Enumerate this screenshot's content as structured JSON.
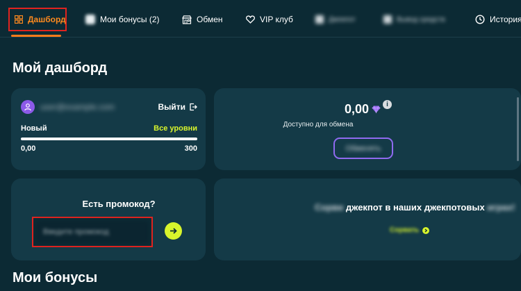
{
  "nav": {
    "items": [
      {
        "label": "Дашборд",
        "icon": "dashboard-grid-icon",
        "active": true
      },
      {
        "label": "Мои бонусы (2)",
        "icon": "gift-icon"
      },
      {
        "label": "Обмен",
        "icon": "store-icon"
      },
      {
        "label": "VIP клуб",
        "icon": "heart-icon"
      },
      {
        "label": "Джекпот",
        "icon": "blurred-icon",
        "blurred": true
      },
      {
        "label": "Вывод средств",
        "icon": "blurred-icon",
        "blurred": true
      },
      {
        "label": "История",
        "icon": "clock-icon"
      }
    ],
    "accent_color": "#ff8a1e",
    "highlight_color": "#e0231f"
  },
  "page": {
    "title": "Мой дашборд",
    "bonuses_heading": "Мои бонусы"
  },
  "profile": {
    "username": "user@example.com",
    "logout_label": "Выйти",
    "level_name": "Новый",
    "all_levels_label": "Все уровни",
    "progress_min": "0,00",
    "progress_max": "300",
    "progress_fraction": 0
  },
  "balance": {
    "amount": "0,00",
    "caption": "Доступно для обмена",
    "info_icon_label": "i",
    "exchange_button": "Обменять"
  },
  "promo": {
    "title": "Есть промокод?",
    "placeholder": "Введите промокод"
  },
  "jackpot": {
    "prefix": "Сорви",
    "text": "джекпот в наших джекпотовых",
    "suffix": "играх!",
    "link": "Сорвать"
  },
  "colors": {
    "background": "#0c2a34",
    "card": "#143a47",
    "lime": "#d8f42c",
    "purple": "#8c5ae8"
  }
}
